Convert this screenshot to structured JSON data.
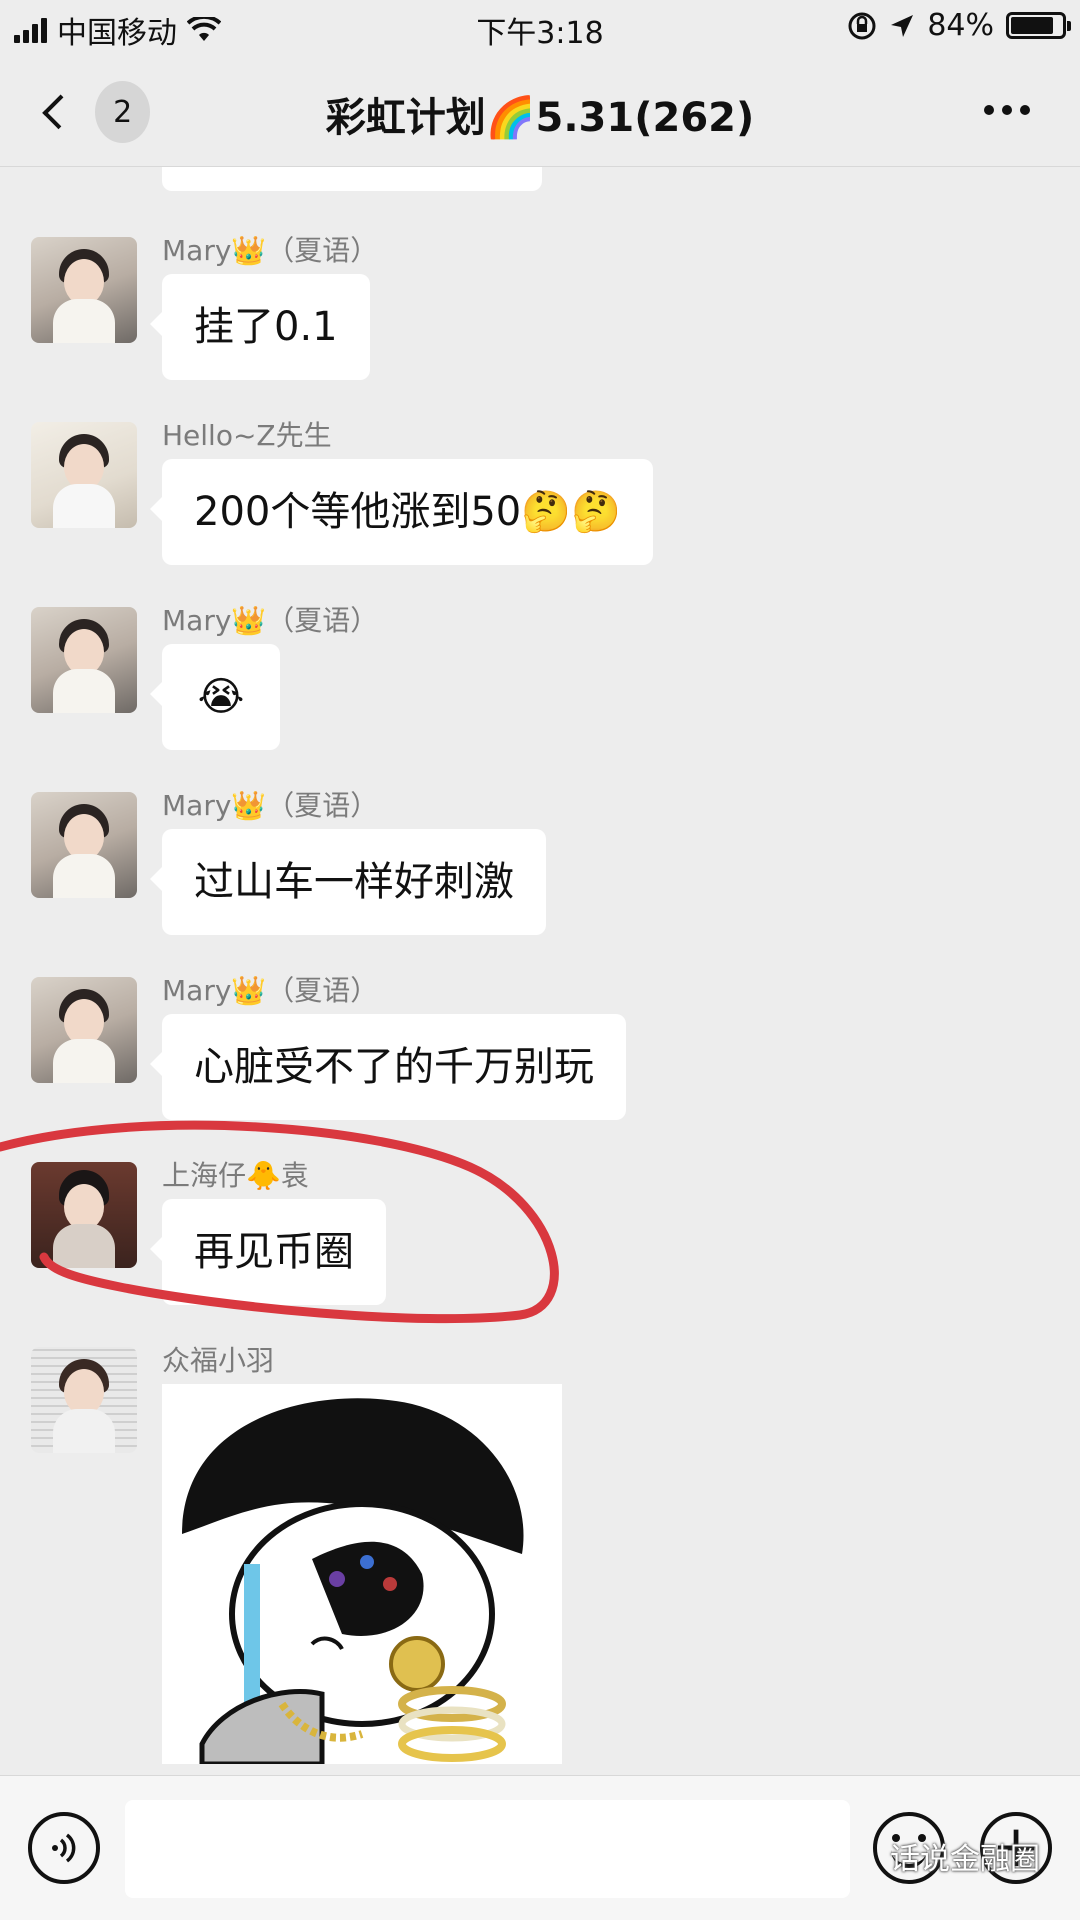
{
  "status_bar": {
    "carrier": "中国移动",
    "time": "下午3:18",
    "battery_percent": "84%",
    "battery_level": 0.84
  },
  "nav": {
    "unread_count": "2",
    "title": "彩虹计划🌈5.31(262)"
  },
  "messages": [
    {
      "sender": "Mary👑（夏语）",
      "text": "挂了0.1"
    },
    {
      "sender": "Hello~Z先生",
      "text": "200个等他涨到50🤔🤔"
    },
    {
      "sender": "Mary👑（夏语）",
      "text": "😭"
    },
    {
      "sender": "Mary👑（夏语）",
      "text": "过山车一样好刺激"
    },
    {
      "sender": "Mary👑（夏语）",
      "text": "心脏受不了的千万别玩"
    },
    {
      "sender": "上海仔🐥袁",
      "text": "再见币圈"
    },
    {
      "sender": "众福小羽",
      "text": ""
    }
  ],
  "input_bar": {
    "placeholder": "",
    "watermark": "话说金融圈"
  },
  "colors": {
    "background": "#ededed",
    "bubble": "#ffffff",
    "annotation": "#d9383f"
  },
  "icons": [
    "back-chevron-icon",
    "more-icon",
    "voice-icon",
    "emoji-icon",
    "plus-icon",
    "wifi-icon",
    "location-icon",
    "lock-rotation-icon"
  ]
}
